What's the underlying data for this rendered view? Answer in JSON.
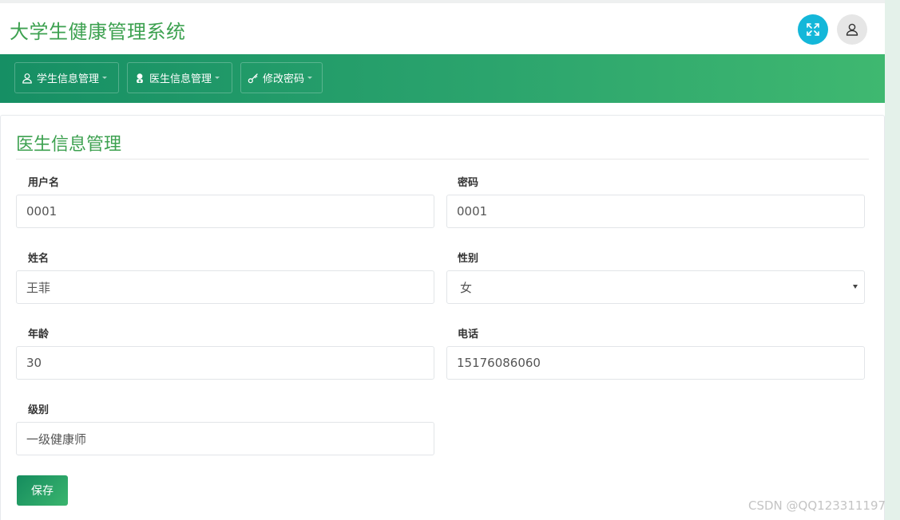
{
  "header": {
    "app_title": "大学生健康管理系统",
    "fullscreen_icon": "expand-arrows-icon",
    "user_icon": "user-icon",
    "colors": {
      "title": "#3da150",
      "fullscreen_button": "#14b7d9"
    }
  },
  "navbar": {
    "items": [
      {
        "label": "学生信息管理",
        "icon": "user-outline-icon"
      },
      {
        "label": "医生信息管理",
        "icon": "doctor-icon"
      },
      {
        "label": "修改密码",
        "icon": "key-icon"
      }
    ],
    "colors": {
      "gradient_start": "#168f64",
      "gradient_end": "#3fb870"
    }
  },
  "form": {
    "title": "医生信息管理",
    "fields": {
      "username": {
        "label": "用户名",
        "value": "0001"
      },
      "password": {
        "label": "密码",
        "value": "0001"
      },
      "name": {
        "label": "姓名",
        "value": "王菲"
      },
      "gender": {
        "label": "性别",
        "value": "女"
      },
      "age": {
        "label": "年龄",
        "value": "30"
      },
      "phone": {
        "label": "电话",
        "value": "15176086060"
      },
      "level": {
        "label": "级别",
        "value": "一级健康师"
      }
    },
    "save_label": "保存"
  },
  "watermark": "CSDN @QQ123311197"
}
